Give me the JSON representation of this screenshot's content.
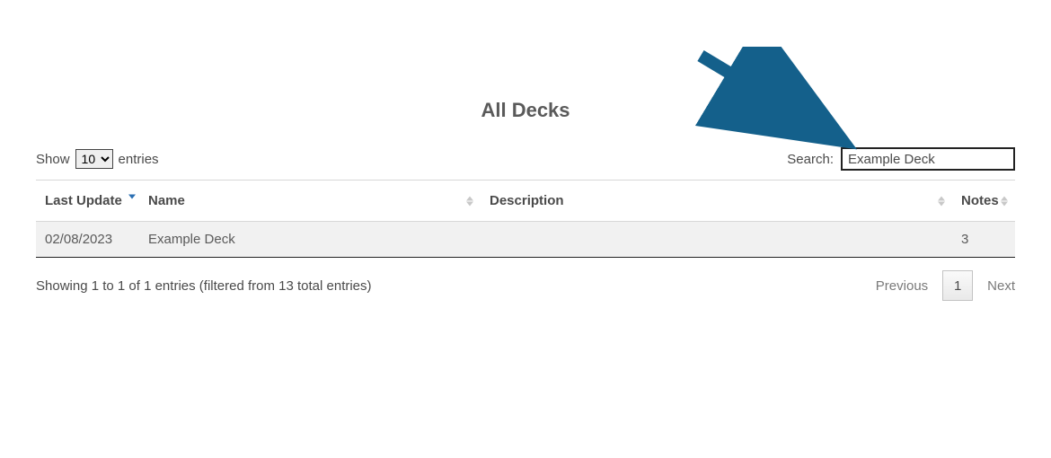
{
  "title": "All Decks",
  "length_control": {
    "prefix": "Show",
    "suffix": "entries",
    "selected": "10",
    "options": [
      "10"
    ]
  },
  "search": {
    "label": "Search:",
    "value": "Example Deck"
  },
  "columns": {
    "last_update": "Last Update",
    "name": "Name",
    "description": "Description",
    "notes": "Notes"
  },
  "rows": [
    {
      "last_update": "02/08/2023",
      "name": "Example Deck",
      "description": "",
      "notes": "3"
    }
  ],
  "info_text": "Showing 1 to 1 of 1 entries (filtered from 13 total entries)",
  "pagination": {
    "previous": "Previous",
    "next": "Next",
    "current": "1"
  }
}
